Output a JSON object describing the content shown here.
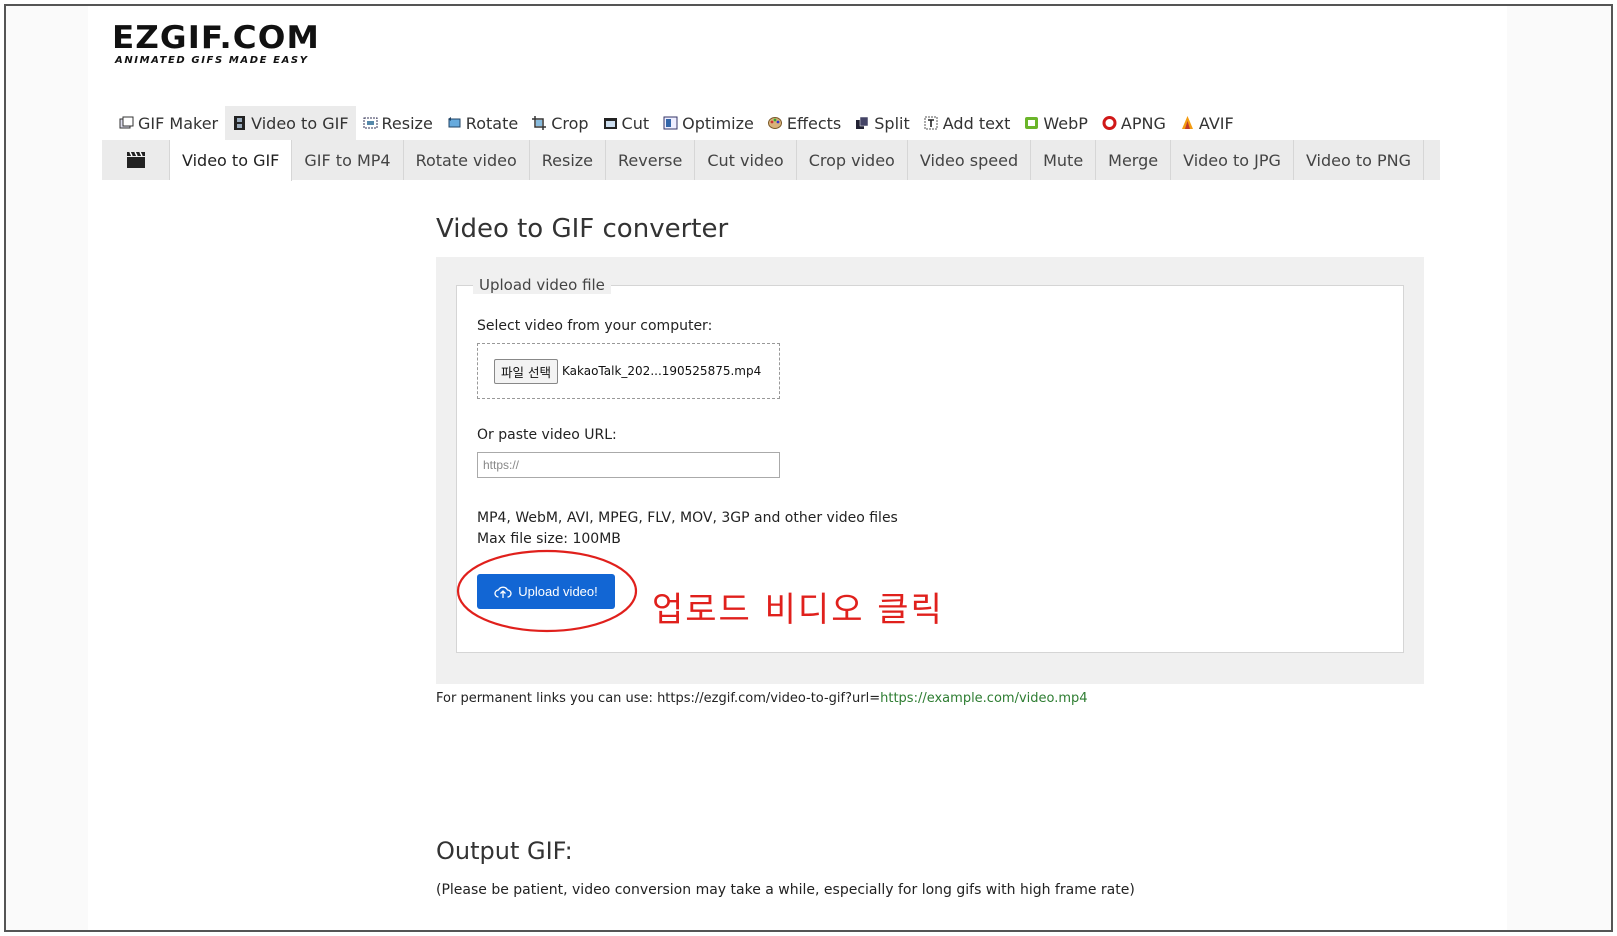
{
  "logo": {
    "main": "EZGIF.COM",
    "tagline": "ANIMATED GIFS MADE EASY"
  },
  "main_nav": [
    {
      "label": "GIF Maker",
      "icon": "gif-maker-icon",
      "active": false
    },
    {
      "label": "Video to GIF",
      "icon": "film-icon",
      "active": true
    },
    {
      "label": "Resize",
      "icon": "resize-icon",
      "active": false
    },
    {
      "label": "Rotate",
      "icon": "rotate-icon",
      "active": false
    },
    {
      "label": "Crop",
      "icon": "crop-icon",
      "active": false
    },
    {
      "label": "Cut",
      "icon": "cut-icon",
      "active": false
    },
    {
      "label": "Optimize",
      "icon": "optimize-icon",
      "active": false
    },
    {
      "label": "Effects",
      "icon": "effects-icon",
      "active": false
    },
    {
      "label": "Split",
      "icon": "split-icon",
      "active": false
    },
    {
      "label": "Add text",
      "icon": "add-text-icon",
      "active": false
    },
    {
      "label": "WebP",
      "icon": "webp-icon",
      "active": false
    },
    {
      "label": "APNG",
      "icon": "apng-icon",
      "active": false
    },
    {
      "label": "AVIF",
      "icon": "avif-icon",
      "active": false
    }
  ],
  "sub_nav": [
    {
      "label": "Video to GIF",
      "active": true
    },
    {
      "label": "GIF to MP4",
      "active": false
    },
    {
      "label": "Rotate video",
      "active": false
    },
    {
      "label": "Resize",
      "active": false
    },
    {
      "label": "Reverse",
      "active": false
    },
    {
      "label": "Cut video",
      "active": false
    },
    {
      "label": "Crop video",
      "active": false
    },
    {
      "label": "Video speed",
      "active": false
    },
    {
      "label": "Mute",
      "active": false
    },
    {
      "label": "Merge",
      "active": false
    },
    {
      "label": "Video to JPG",
      "active": false
    },
    {
      "label": "Video to PNG",
      "active": false
    }
  ],
  "page": {
    "title": "Video to GIF converter",
    "legend": "Upload video file",
    "select_label": "Select video from your computer:",
    "file_button": "파일 선택",
    "file_name": "KakaoTalk_202...190525875.mp4",
    "url_label": "Or paste video URL:",
    "url_placeholder": "https://",
    "formats_line": "MP4, WebM, AVI, MPEG, FLV, MOV, 3GP and other video files",
    "max_size_line": "Max file size: 100MB",
    "upload_button": "Upload video!",
    "annotation": "업로드 비디오 클릭",
    "perma_prefix": "For permanent links you can use: https://ezgif.com/video-to-gif?url=",
    "perma_example": "https://example.com/video.mp4",
    "output_title": "Output GIF:",
    "output_note": "(Please be patient, video conversion may take a while, especially for long gifs with high frame rate)"
  },
  "colors": {
    "upload_button": "#1266d4",
    "annotation": "#e0201c",
    "link": "#2e7d32",
    "nav_bar": "#ebebeb"
  }
}
